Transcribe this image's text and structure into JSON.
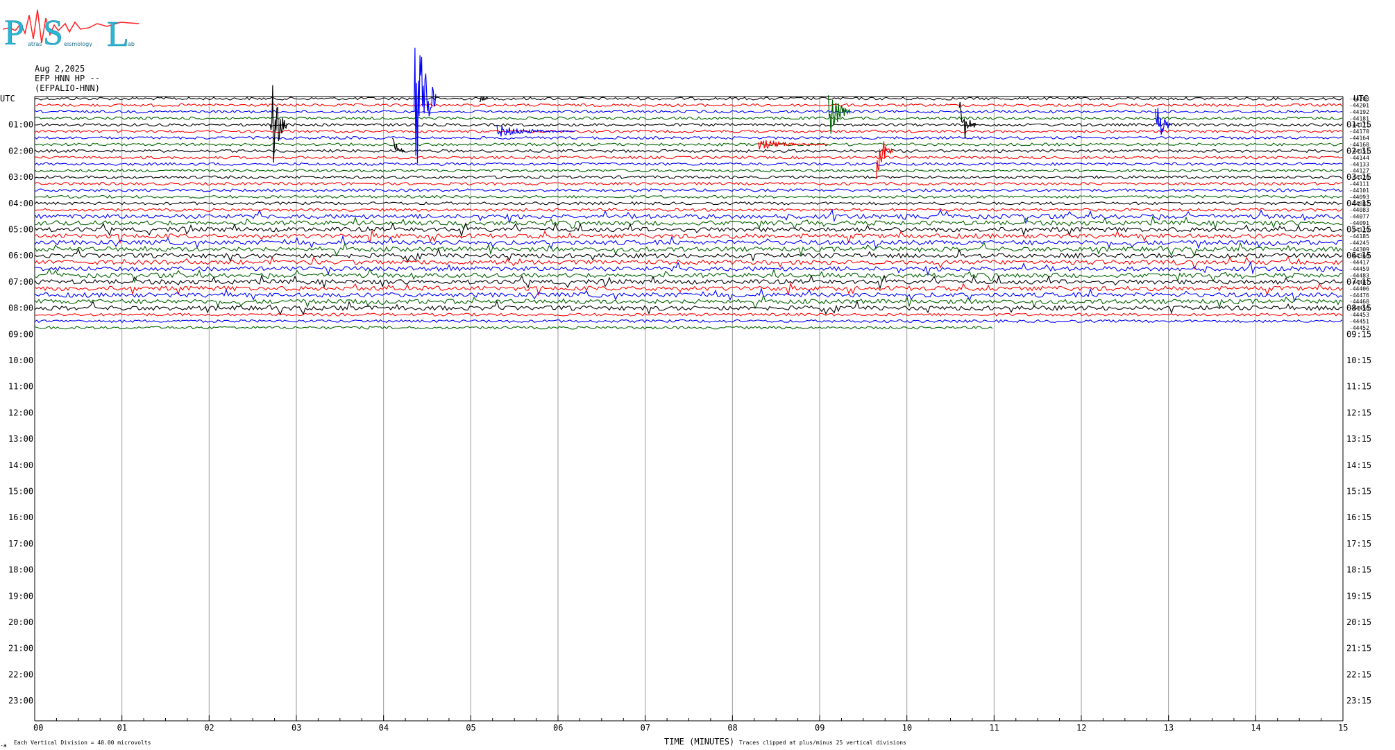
{
  "logo": {
    "letters": [
      "P",
      "S",
      "L"
    ],
    "small_words": [
      "atras",
      "eismology",
      "ab"
    ]
  },
  "header": {
    "date": "Aug 2,2025",
    "station": "EFP HNN HP --",
    "station_id": "(EFPALIO-HNN)"
  },
  "labels": {
    "utc_left": "UTC",
    "utc_right": "UTC",
    "xlabel": "TIME (MINUTES)",
    "scale_note": "Each Vertical Division =   40.00 microvolts",
    "clip_note": "Traces clipped at plus/minus 25 vertical divisions",
    "corner_mark": "-a"
  },
  "chart_data": {
    "type": "line",
    "title": "",
    "xlabel": "TIME (MINUTES)",
    "xlim": [
      0,
      15
    ],
    "x_ticks": [
      "00",
      "01",
      "02",
      "03",
      "04",
      "05",
      "06",
      "07",
      "08",
      "09",
      "10",
      "11",
      "12",
      "13",
      "14",
      "15"
    ],
    "left_hour_labels": [
      "01:00",
      "02:00",
      "03:00",
      "04:00",
      "05:00",
      "06:00",
      "07:00",
      "08:00",
      "09:00",
      "10:00",
      "11:00",
      "12:00",
      "13:00",
      "14:00",
      "15:00",
      "16:00",
      "17:00",
      "18:00",
      "19:00",
      "20:00",
      "21:00",
      "22:00",
      "23:00"
    ],
    "right_hour_labels": [
      "01:15",
      "02:15",
      "03:15",
      "04:15",
      "05:15",
      "06:15",
      "07:15",
      "08:15",
      "09:15",
      "10:15",
      "11:15",
      "12:15",
      "13:15",
      "14:15",
      "15:15",
      "16:15",
      "17:15",
      "18:15",
      "19:15",
      "20:15",
      "21:15",
      "22:15",
      "23:15"
    ],
    "trace_interval_minutes": 15,
    "recorded_traces": 36,
    "last_trace_end_minute": 11,
    "trace_colors": [
      "#000000",
      "#ff0000",
      "#0000ff",
      "#006400"
    ],
    "offsets": [
      "-44208",
      "-44201",
      "-44192",
      "-44181",
      "-44171",
      "-44170",
      "-44164",
      "-44160",
      "-44151",
      "-44144",
      "-44133",
      "-44127",
      "-44120",
      "-44111",
      "-44101",
      "-44093",
      "-44082",
      "-44083",
      "-44077",
      "-44091",
      "-44129",
      "-44185",
      "-44245",
      "-44309",
      "-44366",
      "-44417",
      "-44459",
      "-44483",
      "-44487",
      "-44406",
      "-44476",
      "-44460",
      "-44456",
      "-44453",
      "-44451",
      "-44452"
    ],
    "events": [
      {
        "minute": 4.35,
        "trace": 0,
        "amplitude": 45,
        "color": "#0000ff",
        "length": 0.25
      },
      {
        "minute": 2.7,
        "trace": 4,
        "amplitude": 22,
        "color": "#000000",
        "length": 0.2
      },
      {
        "minute": 9.1,
        "trace": 2,
        "amplitude": 14,
        "color": "#006400",
        "length": 0.25
      },
      {
        "minute": 10.6,
        "trace": 4,
        "amplitude": 12,
        "color": "#000000",
        "length": 0.2
      },
      {
        "minute": 12.85,
        "trace": 4,
        "amplitude": 9,
        "color": "#0000ff",
        "length": 0.2
      },
      {
        "minute": 9.65,
        "trace": 8,
        "amplitude": 12,
        "color": "#ff0000",
        "length": 0.2
      },
      {
        "minute": 4.1,
        "trace": 8,
        "amplitude": 6,
        "color": "#000000",
        "length": 0.15
      },
      {
        "minute": 5.1,
        "trace": 0,
        "amplitude": 2,
        "color": "#000000",
        "length": 0.1
      },
      {
        "minute": 8.3,
        "trace": 7,
        "amplitude": 2,
        "color": "#ff0000",
        "length": 0.8
      },
      {
        "minute": 5.3,
        "trace": 5,
        "amplitude": 2,
        "color": "#0000ff",
        "length": 0.9
      }
    ]
  }
}
